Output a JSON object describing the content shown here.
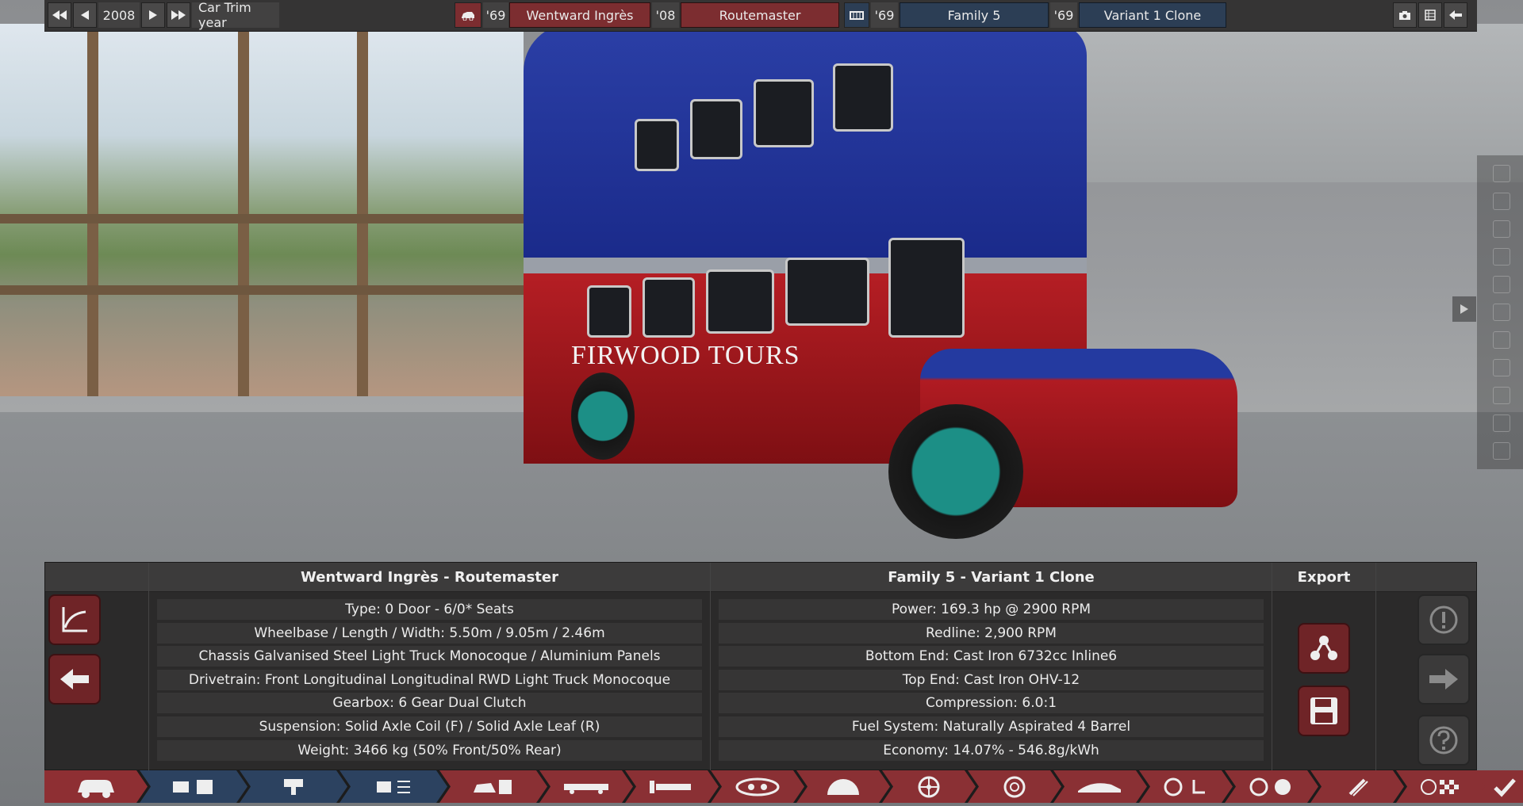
{
  "topbar": {
    "year": "2008",
    "year_label": "Car Trim year",
    "car_model": {
      "year": "'69",
      "name": "Wentward Ingrès"
    },
    "car_trim": {
      "year": "'08",
      "name": "Routemaster"
    },
    "engine_family": {
      "year": "'69",
      "name": "Family 5"
    },
    "engine_variant": {
      "year": "'69",
      "name": "Variant 1 Clone"
    }
  },
  "left_panel": {
    "title": "Wentward Ingrès - Routemaster",
    "rows": [
      "Type: 0 Door - 6/0* Seats",
      "Wheelbase / Length / Width: 5.50m / 9.05m / 2.46m",
      "Chassis Galvanised Steel Light Truck Monocoque / Aluminium Panels",
      "Drivetrain: Front Longitudinal Longitudinal RWD Light Truck Monocoque",
      "Gearbox: 6 Gear Dual Clutch",
      "Suspension: Solid Axle Coil (F) / Solid Axle Leaf (R)",
      "Weight: 3466 kg (50% Front/50% Rear)"
    ]
  },
  "right_panel": {
    "title": "Family 5 - Variant 1 Clone",
    "rows": [
      "Power: 169.3 hp @ 2900 RPM",
      "Redline:  2,900 RPM",
      "Bottom End: Cast Iron 6732cc Inline6",
      "Top End: Cast Iron OHV-12",
      "Compression: 6.0:1",
      "Fuel System: Naturally Aspirated 4 Barrel",
      "Economy: 14.07% - 546.8g/kWh"
    ]
  },
  "export": {
    "title": "Export"
  },
  "scene_text": {
    "sign": "FIRWOOD  TOURS"
  },
  "colors": {
    "accent_red": "#8e2f33",
    "accent_blue": "#2c4260",
    "panel": "#2b2a2a"
  }
}
